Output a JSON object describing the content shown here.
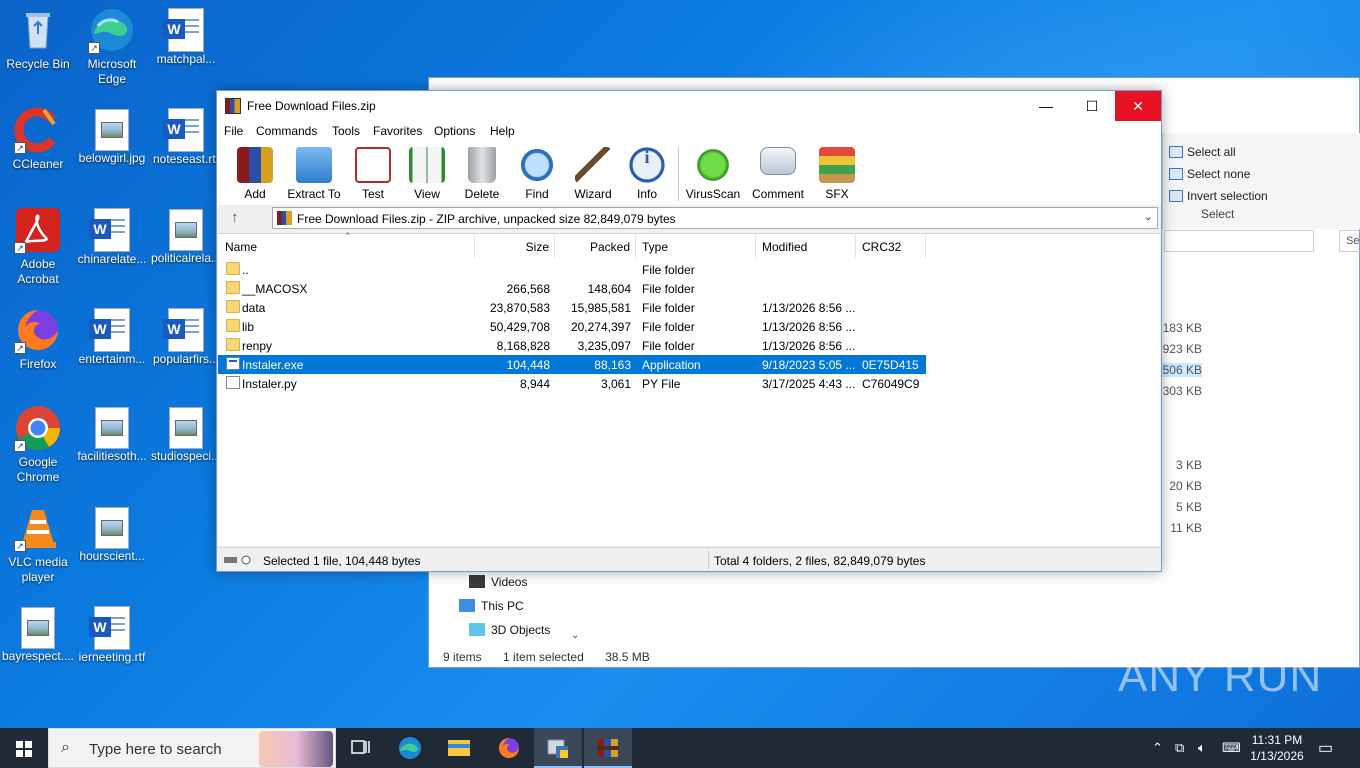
{
  "desktop_icons": [
    {
      "label": "Recycle Bin"
    },
    {
      "label": "Microsoft Edge"
    },
    {
      "label": "matchpal..."
    },
    {
      "label": "CCleaner"
    },
    {
      "label": "belowgirl.jpg"
    },
    {
      "label": "noteseast.rtf"
    },
    {
      "label": "Adobe Acrobat"
    },
    {
      "label": "chinarelate..."
    },
    {
      "label": "politicalrela..."
    },
    {
      "label": "Firefox"
    },
    {
      "label": "entertainm..."
    },
    {
      "label": "popularfirs..."
    },
    {
      "label": "Google Chrome"
    },
    {
      "label": "facilitiesoth..."
    },
    {
      "label": "studiospeci..."
    },
    {
      "label": "VLC media player"
    },
    {
      "label": "hourscient..."
    },
    {
      "label": "bayrespect...."
    },
    {
      "label": "ierneeting.rtf"
    }
  ],
  "explorer": {
    "ribbon": {
      "select_all": "Select all",
      "select_none": "Select none",
      "invert_selection": "Invert selection",
      "group_label": "Select"
    },
    "search_placeholder": "Sea",
    "sizes": [
      "183 KB",
      "923 KB",
      "506 KB",
      "303 KB",
      "3 KB",
      "20 KB",
      "5 KB",
      "11 KB"
    ],
    "nav": {
      "videos": "Videos",
      "this_pc": "This PC",
      "objects3d": "3D Objects"
    },
    "status": {
      "items": "9 items",
      "selected": "1 item selected",
      "size": "38.5 MB"
    }
  },
  "winrar": {
    "title": "Free Download Files.zip",
    "menu": [
      "File",
      "Commands",
      "Tools",
      "Favorites",
      "Options",
      "Help"
    ],
    "toolbar": [
      "Add",
      "Extract To",
      "Test",
      "View",
      "Delete",
      "Find",
      "Wizard",
      "Info",
      "VirusScan",
      "Comment",
      "SFX"
    ],
    "path": "Free Download Files.zip - ZIP archive, unpacked size 82,849,079 bytes",
    "columns": {
      "name": "Name",
      "size": "Size",
      "packed": "Packed",
      "type": "Type",
      "modified": "Modified",
      "crc": "CRC32"
    },
    "rows": [
      {
        "name": "..",
        "size": "",
        "packed": "",
        "type": "File folder",
        "modified": "",
        "crc": "",
        "icon": "folder"
      },
      {
        "name": "__MACOSX",
        "size": "266,568",
        "packed": "148,604",
        "type": "File folder",
        "modified": "",
        "crc": "",
        "icon": "folder"
      },
      {
        "name": "data",
        "size": "23,870,583",
        "packed": "15,985,581",
        "type": "File folder",
        "modified": "1/13/2026 8:56 ...",
        "crc": "",
        "icon": "folder"
      },
      {
        "name": "lib",
        "size": "50,429,708",
        "packed": "20,274,397",
        "type": "File folder",
        "modified": "1/13/2026 8:56 ...",
        "crc": "",
        "icon": "folder"
      },
      {
        "name": "renpy",
        "size": "8,168,828",
        "packed": "3,235,097",
        "type": "File folder",
        "modified": "1/13/2026 8:56 ...",
        "crc": "",
        "icon": "folder"
      },
      {
        "name": "Instaler.exe",
        "size": "104,448",
        "packed": "88,163",
        "type": "Application",
        "modified": "9/18/2023 5:05 ...",
        "crc": "0E75D415",
        "icon": "exe"
      },
      {
        "name": "Instaler.py",
        "size": "8,944",
        "packed": "3,061",
        "type": "PY File",
        "modified": "3/17/2025 4:43 ...",
        "crc": "C76049C9",
        "icon": "py"
      }
    ],
    "status_left": "Selected 1 file, 104,448 bytes",
    "status_right": "Total 4 folders, 2 files, 82,849,079 bytes"
  },
  "taskbar": {
    "search_placeholder": "Type here to search",
    "time": "11:31 PM",
    "date": "1/13/2026"
  },
  "watermark": "ANY RUN"
}
